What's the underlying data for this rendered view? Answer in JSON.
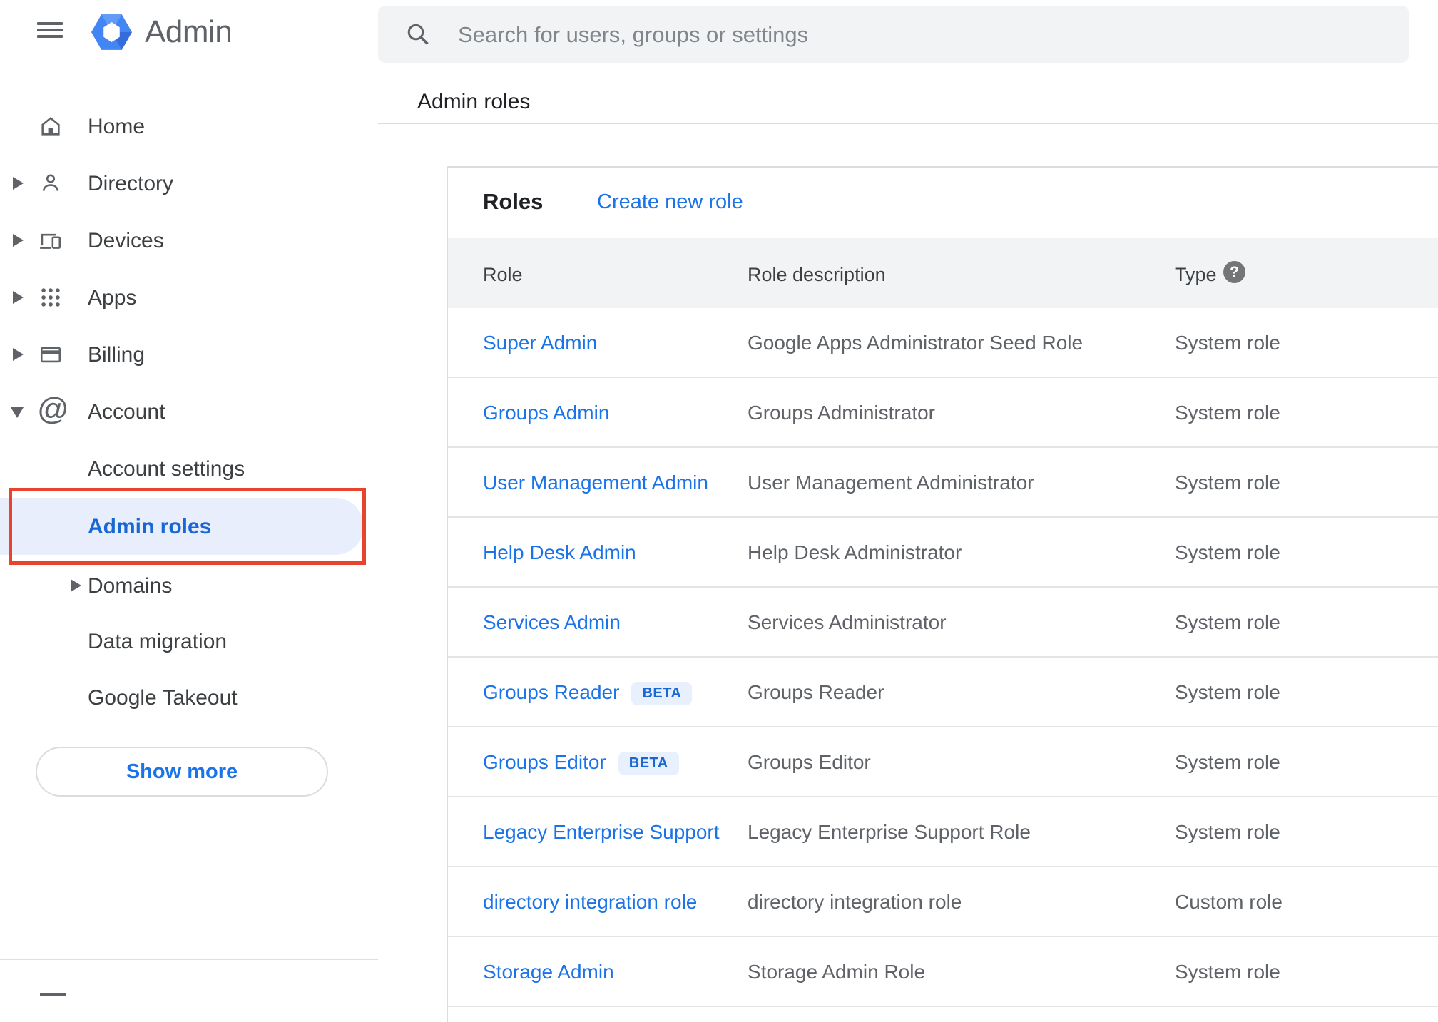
{
  "topbar": {
    "product_name": "Admin",
    "search": {
      "placeholder": "Search for users, groups or settings"
    }
  },
  "sidebar": {
    "items": [
      {
        "label": "Home"
      },
      {
        "label": "Directory"
      },
      {
        "label": "Devices"
      },
      {
        "label": "Apps"
      },
      {
        "label": "Billing"
      },
      {
        "label": "Account"
      }
    ],
    "account_children": [
      {
        "label": "Account settings"
      },
      {
        "label": "Admin roles",
        "selected": true
      },
      {
        "label": "Domains"
      },
      {
        "label": "Data migration"
      },
      {
        "label": "Google Takeout"
      }
    ],
    "show_more_label": "Show more"
  },
  "breadcrumb": "Admin roles",
  "main": {
    "card_title": "Roles",
    "create_link": "Create new role",
    "table": {
      "columns": [
        "Role",
        "Role description",
        "Type"
      ],
      "rows": [
        {
          "role": "Super Admin",
          "description": "Google Apps Administrator Seed Role",
          "type": "System role"
        },
        {
          "role": "Groups Admin",
          "description": "Groups Administrator",
          "type": "System role"
        },
        {
          "role": "User Management Admin",
          "description": "User Management Administrator",
          "type": "System role"
        },
        {
          "role": "Help Desk Admin",
          "description": "Help Desk Administrator",
          "type": "System role"
        },
        {
          "role": "Services Admin",
          "description": "Services Administrator",
          "type": "System role"
        },
        {
          "role": "Groups Reader",
          "badge": "BETA",
          "description": "Groups Reader",
          "type": "System role"
        },
        {
          "role": "Groups Editor",
          "badge": "BETA",
          "description": "Groups Editor",
          "type": "System role"
        },
        {
          "role": "Legacy Enterprise Support",
          "description": "Legacy Enterprise Support Role",
          "type": "System role"
        },
        {
          "role": "directory integration role",
          "description": "directory integration role",
          "type": "Custom role"
        },
        {
          "role": "Storage Admin",
          "description": "Storage Admin Role",
          "type": "System role"
        }
      ]
    }
  },
  "colors": {
    "link_blue": "#1a73e8",
    "selected_blue": "#1967d2",
    "selected_pill_bg": "#e8eefc",
    "badge_bg": "#e8f0fe",
    "annotation_red": "#e8432c",
    "header_band_gray": "#f1f3f4",
    "icon_gray": "#5f6368"
  }
}
